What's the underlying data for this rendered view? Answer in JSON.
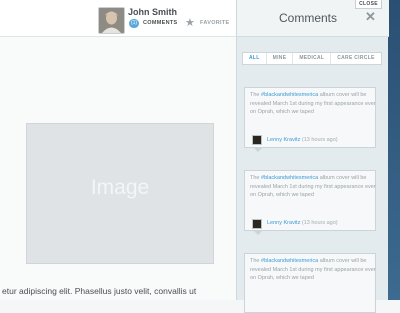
{
  "header": {
    "user_name": "John Smith",
    "comments_label": "COMMENTS",
    "comments_badge": "(1)",
    "favorite_label": "FAVORITE"
  },
  "main": {
    "image_label": "Image",
    "body_text": "etur adipiscing elit. Phasellus justo velit, convallis ut"
  },
  "panel": {
    "title": "Comments",
    "close_label": "CLOSE",
    "close_icon": "✕",
    "filters": [
      "ALL",
      "MINE",
      "MEDICAL",
      "CARE CIRCLE"
    ],
    "active_filter": "ALL",
    "comments": [
      {
        "text_prefix": "The ",
        "hashtag": "#blackandwhitesmerica",
        "text_rest": " album cover will be revealed March 1st during my first appearance ever on Oprah, which we taped",
        "author": "Lenny Kravitz",
        "time": "(13 hours ago)"
      },
      {
        "text_prefix": "The ",
        "hashtag": "#blackandwhitesmerica",
        "text_rest": " album cover will be revealed March 1st during my first appearance ever on Oprah, which we taped",
        "author": "Lenny Kravitz",
        "time": "(13 hours ago)"
      },
      {
        "text_prefix": "The ",
        "hashtag": "#blackandwhitesmerica",
        "text_rest": " album cover will be revealed March 1st during my first appearance ever on Oprah, which we taped",
        "author": "",
        "time": ""
      }
    ]
  },
  "colors": {
    "accent": "#3b9ad6",
    "page_background": "#2a4f73"
  }
}
